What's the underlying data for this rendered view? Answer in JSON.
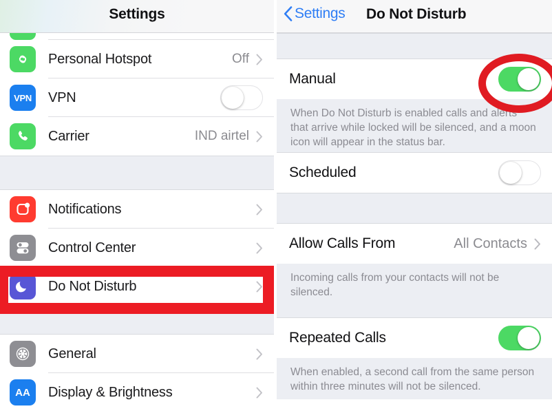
{
  "left_panel": {
    "navbar": {
      "title": "Settings"
    },
    "groups": [
      {
        "rows": [
          {
            "label": "",
            "icon": "wifi-icon",
            "icon_color": "#4cd964",
            "partial": true,
            "accessory": "none"
          },
          {
            "label": "Personal Hotspot",
            "icon": "personal-hotspot-icon",
            "icon_color": "#4cd964",
            "value": "Off",
            "accessory": "chevron"
          },
          {
            "label": "VPN",
            "icon": "vpn-icon",
            "icon_color": "#1b7fef",
            "icon_text": "VPN",
            "accessory": "toggle",
            "toggle_on": false
          },
          {
            "label": "Carrier",
            "icon": "phone-icon",
            "icon_color": "#4cd964",
            "value": "IND airtel",
            "accessory": "chevron"
          }
        ]
      },
      {
        "rows": [
          {
            "label": "Notifications",
            "icon": "notifications-icon",
            "icon_color": "#ff3b30",
            "accessory": "chevron"
          },
          {
            "label": "Control Center",
            "icon": "control-center-icon",
            "icon_color": "#8e8e93",
            "accessory": "chevron"
          },
          {
            "label": "Do Not Disturb",
            "icon": "moon-icon",
            "icon_color": "#5856d6",
            "accessory": "chevron",
            "highlighted": true
          }
        ]
      },
      {
        "rows": [
          {
            "label": "General",
            "icon": "gear-icon",
            "icon_color": "#8e8e93",
            "accessory": "chevron"
          },
          {
            "label": "Display & Brightness",
            "icon": "display-brightness-icon",
            "icon_color": "#1b7fef",
            "icon_text": "AA",
            "accessory": "chevron"
          }
        ]
      }
    ]
  },
  "right_panel": {
    "navbar": {
      "back_label": "Settings",
      "back_icon": "chevron-left-icon",
      "title": "Do Not Disturb"
    },
    "sections": [
      {
        "rows": [
          {
            "label": "Manual",
            "accessory": "toggle",
            "toggle_on": true,
            "annotated": true
          }
        ],
        "footnote": "When Do Not Disturb is enabled calls and alerts that arrive while locked will be silenced, and a moon icon will appear in the status bar."
      },
      {
        "rows": [
          {
            "label": "Scheduled",
            "accessory": "toggle",
            "toggle_on": false
          }
        ],
        "footnote": ""
      },
      {
        "rows": [
          {
            "label": "Allow Calls From",
            "value": "All Contacts",
            "accessory": "chevron"
          }
        ],
        "footnote": "Incoming calls from your contacts will not be silenced."
      },
      {
        "rows": [
          {
            "label": "Repeated Calls",
            "accessory": "toggle",
            "toggle_on": true
          }
        ],
        "footnote": "When enabled, a second call from the same person within three minutes will not be silenced."
      }
    ]
  },
  "annotations": {
    "color": "#e01b22",
    "rect_label": "highlight-do-not-disturb-row",
    "ellipse_label": "highlight-manual-toggle"
  }
}
